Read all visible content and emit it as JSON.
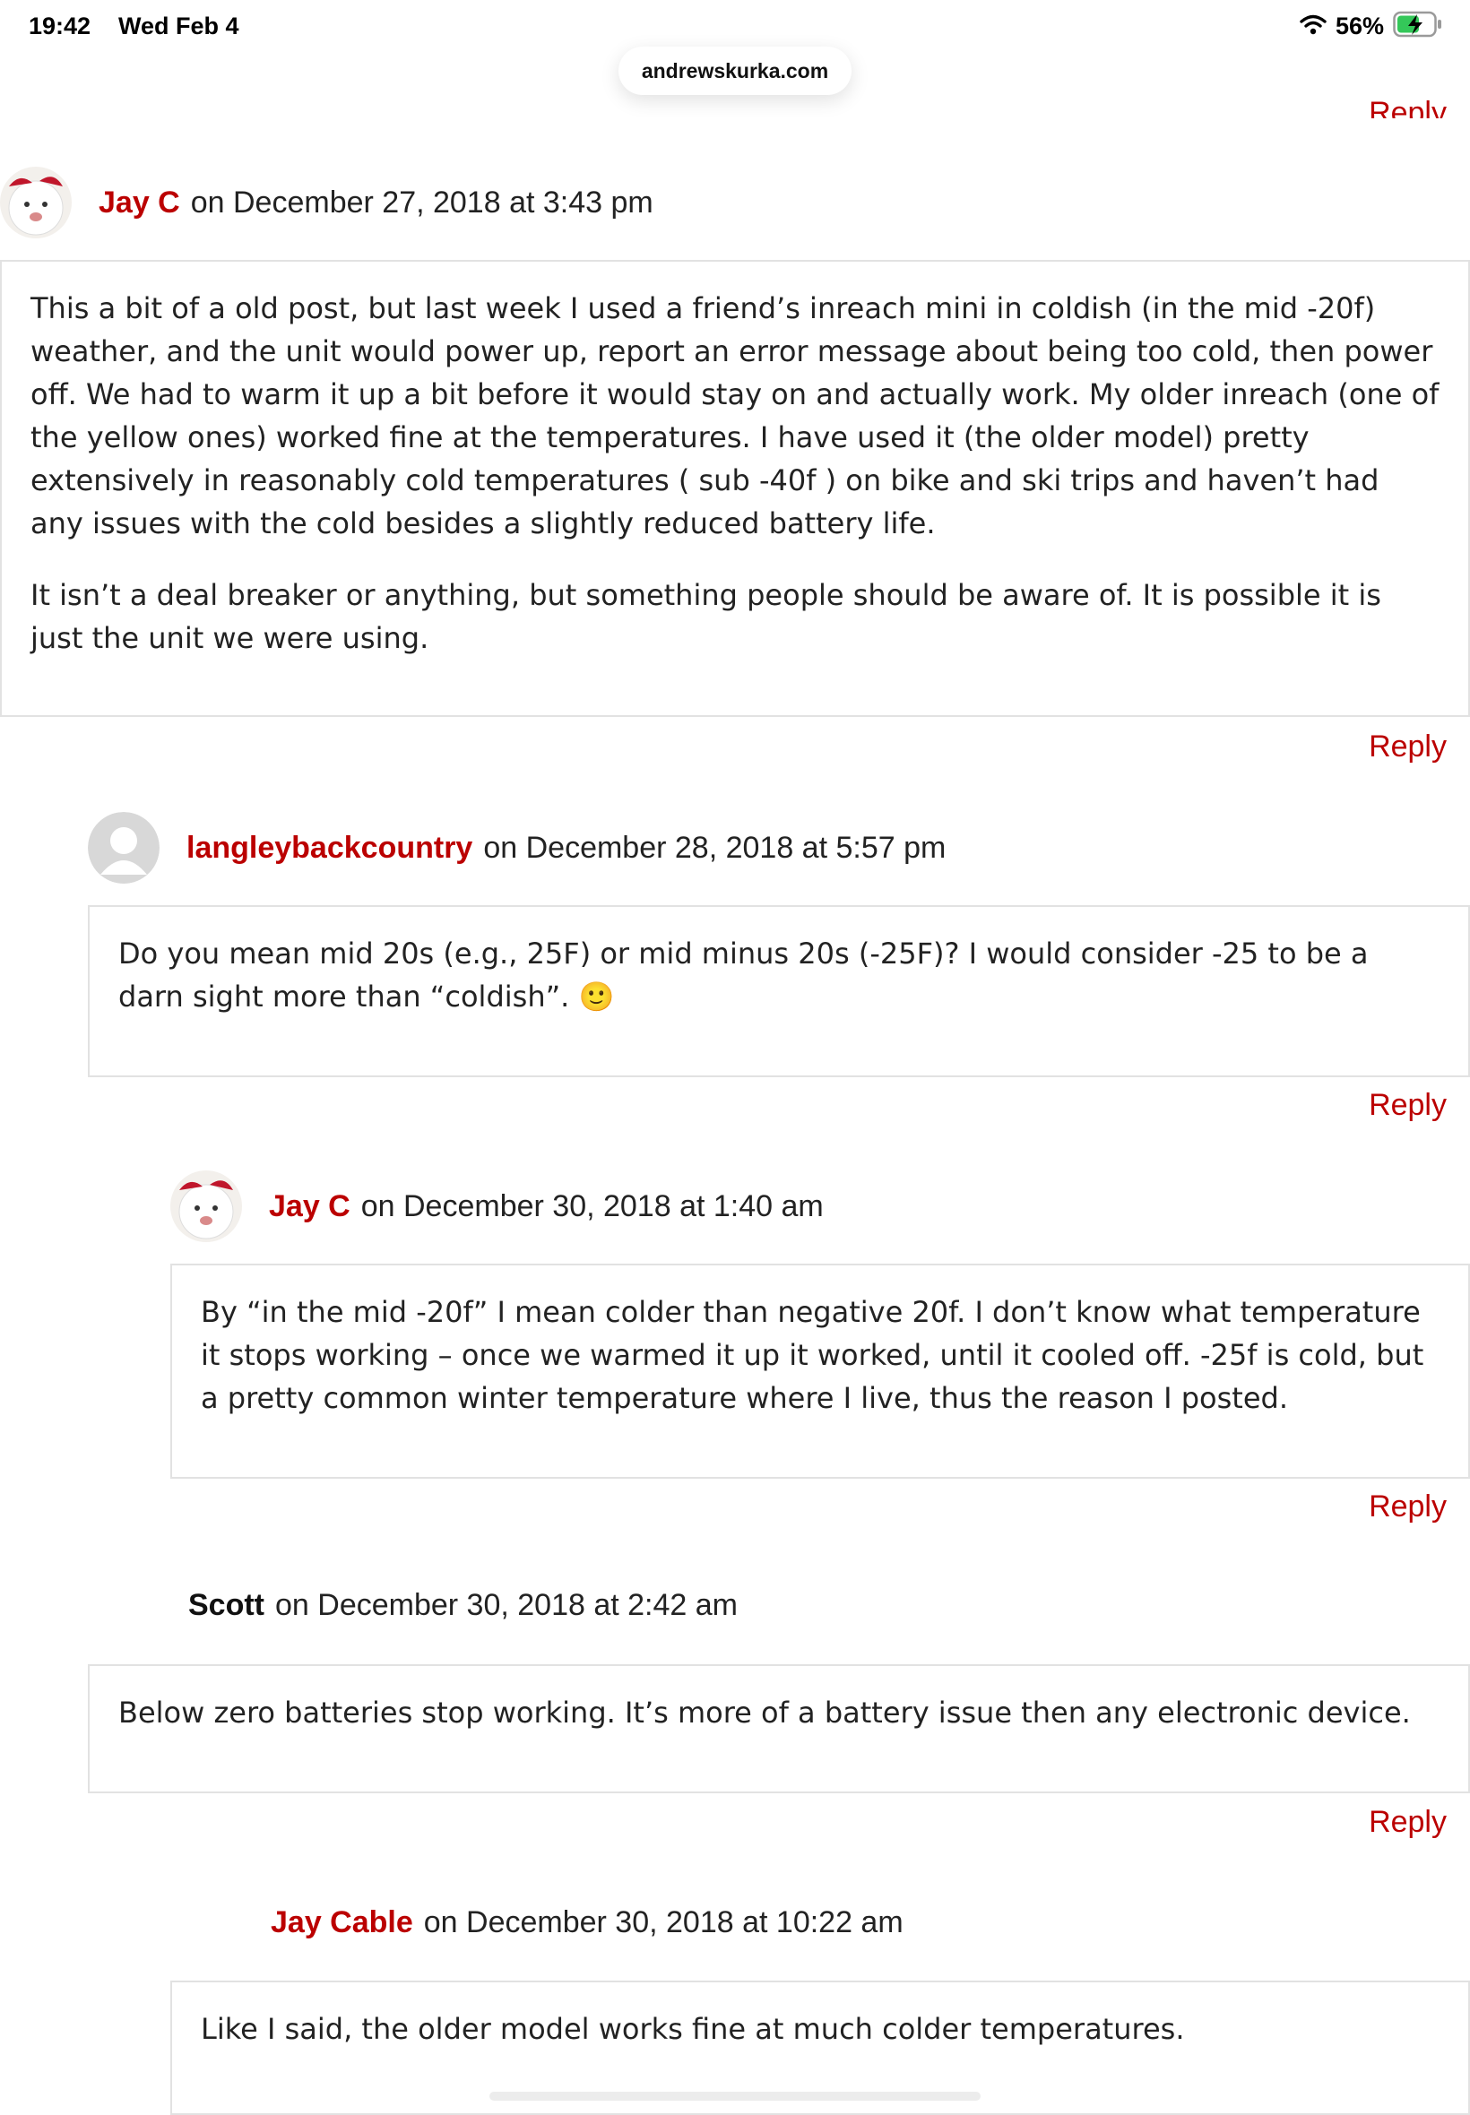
{
  "status_bar": {
    "time": "19:42",
    "date": "Wed Feb 4",
    "battery": "56%"
  },
  "browser": {
    "url": "andrewskurka.com"
  },
  "reply_label": "Reply",
  "comments": [
    {
      "author": "Jay C",
      "meta": "on December 27, 2018 at 3:43 pm",
      "paragraphs": [
        "This a bit of a old post, but last week I used a friend’s inreach mini in coldish (in the mid -20f) weather, and the unit would power up, report an error message about being too cold, then power off. We had to warm it up a bit before it would stay on and actually work. My older inreach (one of the yellow ones) worked fine at the temperatures. I have used it (the older model) pretty extensively in reasonably cold temperatures ( sub -40f ) on bike and ski trips and haven’t had any issues with the cold besides a slightly reduced battery life.",
        "It isn’t a deal breaker or anything, but something people should be aware of. It is possible it is just the unit we were using."
      ]
    },
    {
      "author": "langleybackcountry",
      "meta": "on December 28, 2018 at 5:57 pm",
      "paragraphs": [
        "Do you mean mid 20s (e.g., 25F) or mid minus 20s (-25F)? I would consider -25 to be a darn sight more than “coldish”. 🙂"
      ]
    },
    {
      "author": "Jay C",
      "meta": "on December 30, 2018 at 1:40 am",
      "paragraphs": [
        "By “in the mid -20f” I mean colder than negative 20f. I don’t know what temperature it stops working – once we warmed it up it worked, until it cooled off. -25f is cold, but a pretty common winter temperature where I live, thus the reason I posted."
      ]
    },
    {
      "author": "Scott",
      "meta": "on December 30, 2018 at 2:42 am",
      "paragraphs": [
        "Below zero batteries stop working. It’s more of a battery issue then any electronic device."
      ]
    },
    {
      "author": "Jay Cable",
      "meta": "on December 30, 2018 at 10:22 am",
      "paragraphs": [
        "Like I said, the older model works fine at much colder temperatures."
      ]
    }
  ],
  "colors": {
    "link": "#bb0000",
    "border": "#e2e2e2",
    "battery": "#34c759"
  },
  "icons": [
    "wifi-icon",
    "battery-charging-icon",
    "dog-avatar-icon",
    "default-avatar-icon"
  ]
}
